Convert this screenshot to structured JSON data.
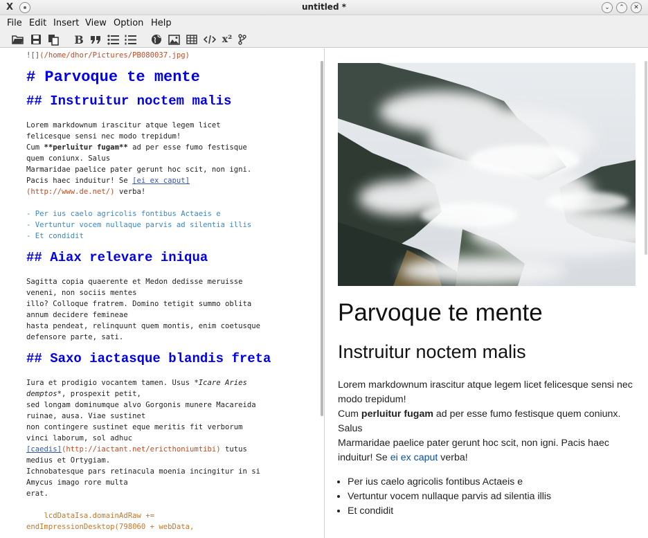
{
  "window": {
    "app_icon": "X",
    "title": "untitled *",
    "buttons": [
      "minimize",
      "maximize",
      "close"
    ],
    "button_glyphs": [
      "⌄",
      "⌃",
      "✕"
    ]
  },
  "menu": {
    "items": [
      "File",
      "Edit",
      "Insert",
      "View",
      "Option",
      "Help"
    ]
  },
  "toolbar": {
    "icons": [
      "open-folder-icon",
      "save-icon",
      "copy-icon",
      "bold-icon",
      "quote-icon",
      "bullet-list-icon",
      "numbered-list-icon",
      "globe-icon",
      "image-icon",
      "table-icon",
      "code-icon",
      "superscript-icon",
      "git-branch-icon"
    ],
    "bold_label": "B",
    "superscript_label": "x²"
  },
  "editor": {
    "image_line_prefix": "![]",
    "image_line_path": "(/home/dhor/Pictures/PB080037.jpg)",
    "h1": "# Parvoque te mente",
    "h2a": "## Instruitur noctem malis",
    "p1_l1": "Lorem markdownum irascitur atque legem licet",
    "p1_l2": "felicesque sensi nec modo trepidum!",
    "p1_l3_a": "Cum ",
    "p1_l3_b": "**perluitur fugam**",
    "p1_l3_c": " ad per esse fumo festisque",
    "p1_l4": "quem coniunx. Salus",
    "p1_l5": "Marmaridae paelice pater gerunt hoc scit, non igni.",
    "p1_l6_a": "Pacis haec induitur! Se ",
    "p1_l6_b": "[ei ex caput]",
    "p1_l7_url": "(http://www.de.net/)",
    "p1_l7_b": " verba!",
    "li1": "- Per ius caelo agricolis fontibus Actaeis e",
    "li2": "- Vertuntur vocem nullaque parvis ad silentia illis",
    "li3": "- Et condidit",
    "h2b": "## Aiax relevare iniqua",
    "p2_l1": "Sagitta copia quaerente et Medon dedisse meruisse",
    "p2_l2": "veneni, non sociis mentes",
    "p2_l3": "illo? Colloque fratrem. Domino tetigit summo oblita",
    "p2_l4": "annum decidere femineae",
    "p2_l5": "hasta pendeat, relinquunt quem montis, enim coetusque",
    "p2_l6": "defensore parte, sati.",
    "h2c": "## Saxo iactasque blandis freta",
    "p3_l1_a": "Iura et prodigio vocantem tamen. Usus ",
    "p3_l1_b": "*Icare Aries",
    "p3_l2_a": "demptos*",
    "p3_l2_b": ", prospexit petit,",
    "p3_l3": "sed longam dominumque alvo Gorgonis munere Macareida",
    "p3_l4": "ruinae, ausa. Viae sustinet",
    "p3_l5": "non contingere sustinet eque meritis fit verborum",
    "p3_l6": "vinci laborum, sol adhuc",
    "p3_l7_link": "[caedis]",
    "p3_l7_url": "(http://iactant.net/ericthoniumtibi)",
    "p3_l7_b": " tutus",
    "p3_l8": "medius et Ortygiam.",
    "p3_l9": "Ichnobatesque pars retinacula moenia incingitur in si",
    "p3_l10": "Amycus imago rore multa",
    "p3_l11": "erat.",
    "code_l1": "    lcdDataIsa.domainAdRaw +=",
    "code_l2": "endImpressionDesktop(798060 + webData,"
  },
  "preview": {
    "h1": "Parvoque te mente",
    "h2": "Instruitur noctem malis",
    "p1": "Lorem markdownum irascitur atque legem licet felicesque sensi nec modo trepidum!",
    "p2_a": "Cum ",
    "p2_bold": "perluitur fugam",
    "p2_b": " ad per esse fumo festisque quem coniunx. Salus",
    "p3_a": "Marmaridae paelice pater gerunt hoc scit, non igni. Pacis haec induitur! Se ",
    "p3_link": "ei ex caput",
    "p3_b": " verba!",
    "list": [
      "Per ius caelo agricolis fontibus Actaeis e",
      "Vertuntur vocem nullaque parvis ad silentia illis",
      "Et condidit"
    ]
  },
  "colors": {
    "heading_blue": "#0000ee",
    "url_orange": "#c04a22",
    "list_blue": "#3b87c7",
    "link_blue": "#0a4fa3"
  }
}
